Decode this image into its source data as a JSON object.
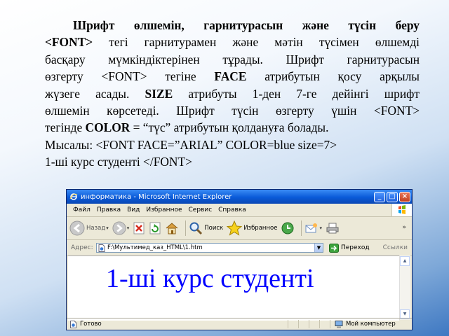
{
  "slide": {
    "line1": "Шрифт өлшемін, гарнитурасын және түсін беру",
    "line2_tag": "<FONT>",
    "line2_rest": " тегі гарнитурамен және мәтін түсімен өлшемді",
    "line3": "басқару мүмкіндіктерінен тұрады. Шрифт гарнитурасын",
    "line4_a": "өзгерту <FONT> тегіне ",
    "line4_face": "FACE",
    "line4_b": " атрибутын қосу арқылы",
    "line5_a": "жүзеге асады. ",
    "line5_size": "SIZE",
    "line5_b": " атрибуты 1-ден 7-ге дейінгі шрифт",
    "line6": "өлшемін көрсетеді. Шрифт түсін өзгерту үшін <FONT>",
    "line7_a": "тегінде ",
    "line7_color": "COLOR",
    "line7_b": " = “түс” атрибутын қолдануға болады.",
    "line8": "Мысалы: <FONT FACE=”ARIAL”  COLOR=blue size=7>",
    "line9": "1-ші курс студенті  </FONT>"
  },
  "browser": {
    "title": "информатика - Microsoft Internet Explorer",
    "menu": [
      "Файл",
      "Правка",
      "Вид",
      "Избранное",
      "Сервис",
      "Справка"
    ],
    "toolbar": {
      "back": "Назад",
      "search": "Поиск",
      "favorites": "Избранное"
    },
    "address_label": "Адрес:",
    "address_value": "F:\\Мультимед_каз_HTML\\1.htm",
    "go_label": "Переход",
    "links_label": "Ссылки",
    "page_text": "1-ші курс студенті",
    "page_text_color": "#0000ff",
    "status_left": "Готово",
    "status_zone": "Мой компьютер"
  },
  "icons": [
    "ie-icon",
    "windows-logo-icon",
    "back-arrow-icon",
    "forward-arrow-icon",
    "stop-icon",
    "refresh-icon",
    "home-icon",
    "search-icon",
    "favorites-star-icon",
    "history-icon",
    "mail-icon",
    "print-icon",
    "page-icon",
    "go-arrow-icon"
  ]
}
